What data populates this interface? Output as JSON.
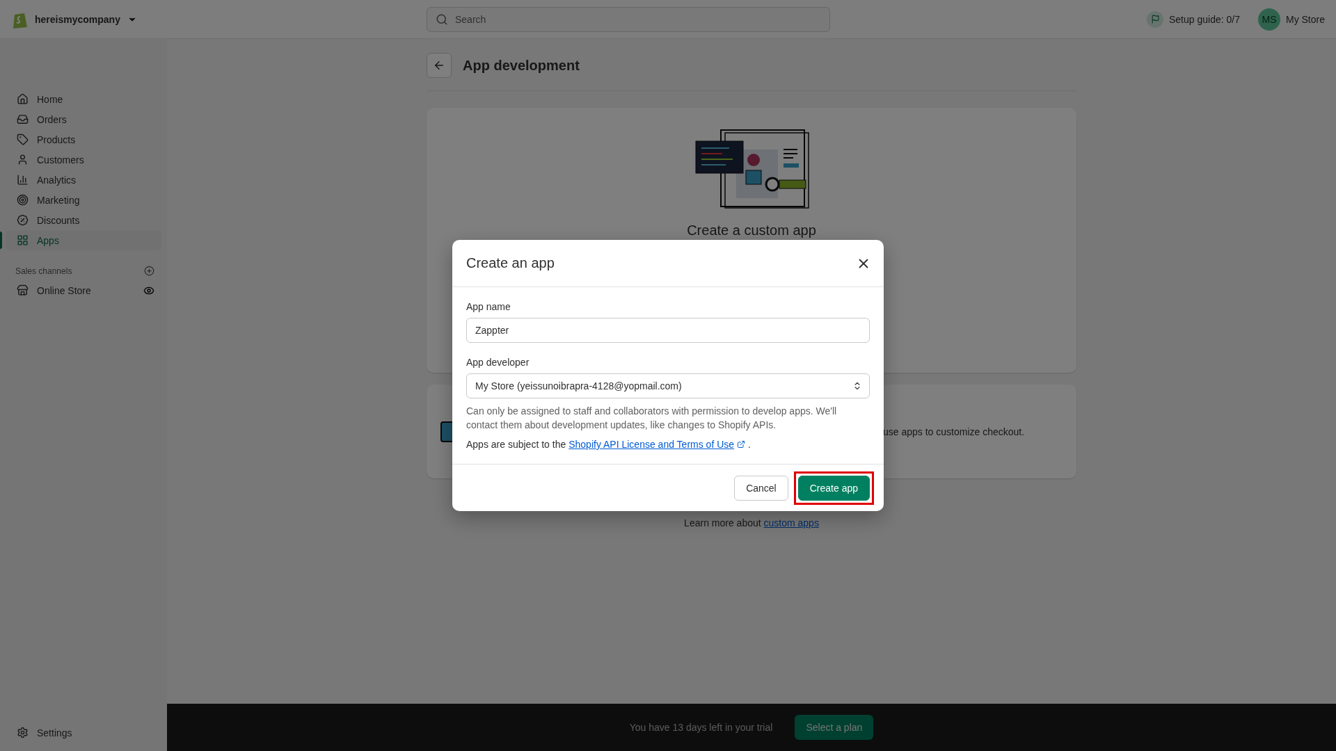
{
  "topbar": {
    "store_name": "hereismycompany",
    "search": {
      "placeholder": "Search"
    },
    "setup_guide": "Setup guide: 0/7",
    "avatar_initials": "MS",
    "account_name": "My Store"
  },
  "sidebar": {
    "items": [
      {
        "label": "Home",
        "selected": false
      },
      {
        "label": "Orders",
        "selected": false
      },
      {
        "label": "Products",
        "selected": false
      },
      {
        "label": "Customers",
        "selected": false
      },
      {
        "label": "Analytics",
        "selected": false
      },
      {
        "label": "Marketing",
        "selected": false
      },
      {
        "label": "Discounts",
        "selected": false
      },
      {
        "label": "Apps",
        "selected": true
      }
    ],
    "sales_channels": {
      "heading": "Sales channels",
      "items": [
        {
          "label": "Online Store",
          "selected": false
        }
      ]
    },
    "settings": "Settings"
  },
  "page": {
    "title": "App development",
    "hero_title": "Create a custom app",
    "partial_text": "use apps to customize checkout.",
    "learn_more": "Learn more about ",
    "learn_more_link": "custom apps"
  },
  "dialog": {
    "title": "Create an app",
    "fields": [
      {
        "label": "App name",
        "kind": "text",
        "value": "Zappter"
      },
      {
        "label": "App developer",
        "kind": "select",
        "value": "My Store (yeissunoibrapra-4128@yopmail.com)",
        "help": "Can only be assigned to staff and collaborators with permission to develop apps. We'll contact them about development updates, like changes to Shopify APIs."
      }
    ],
    "terms_prefix": "Apps are subject to the ",
    "terms_link": "Shopify API License and Terms of Use",
    "terms_suffix": ".",
    "buttons": [
      {
        "label": "Cancel",
        "kind": "secondary",
        "highlighted": false
      },
      {
        "label": "Create app",
        "kind": "primary",
        "highlighted": true
      }
    ]
  },
  "trial_bar": {
    "text": "You have 13 days left in your trial",
    "button": "Select a plan"
  }
}
